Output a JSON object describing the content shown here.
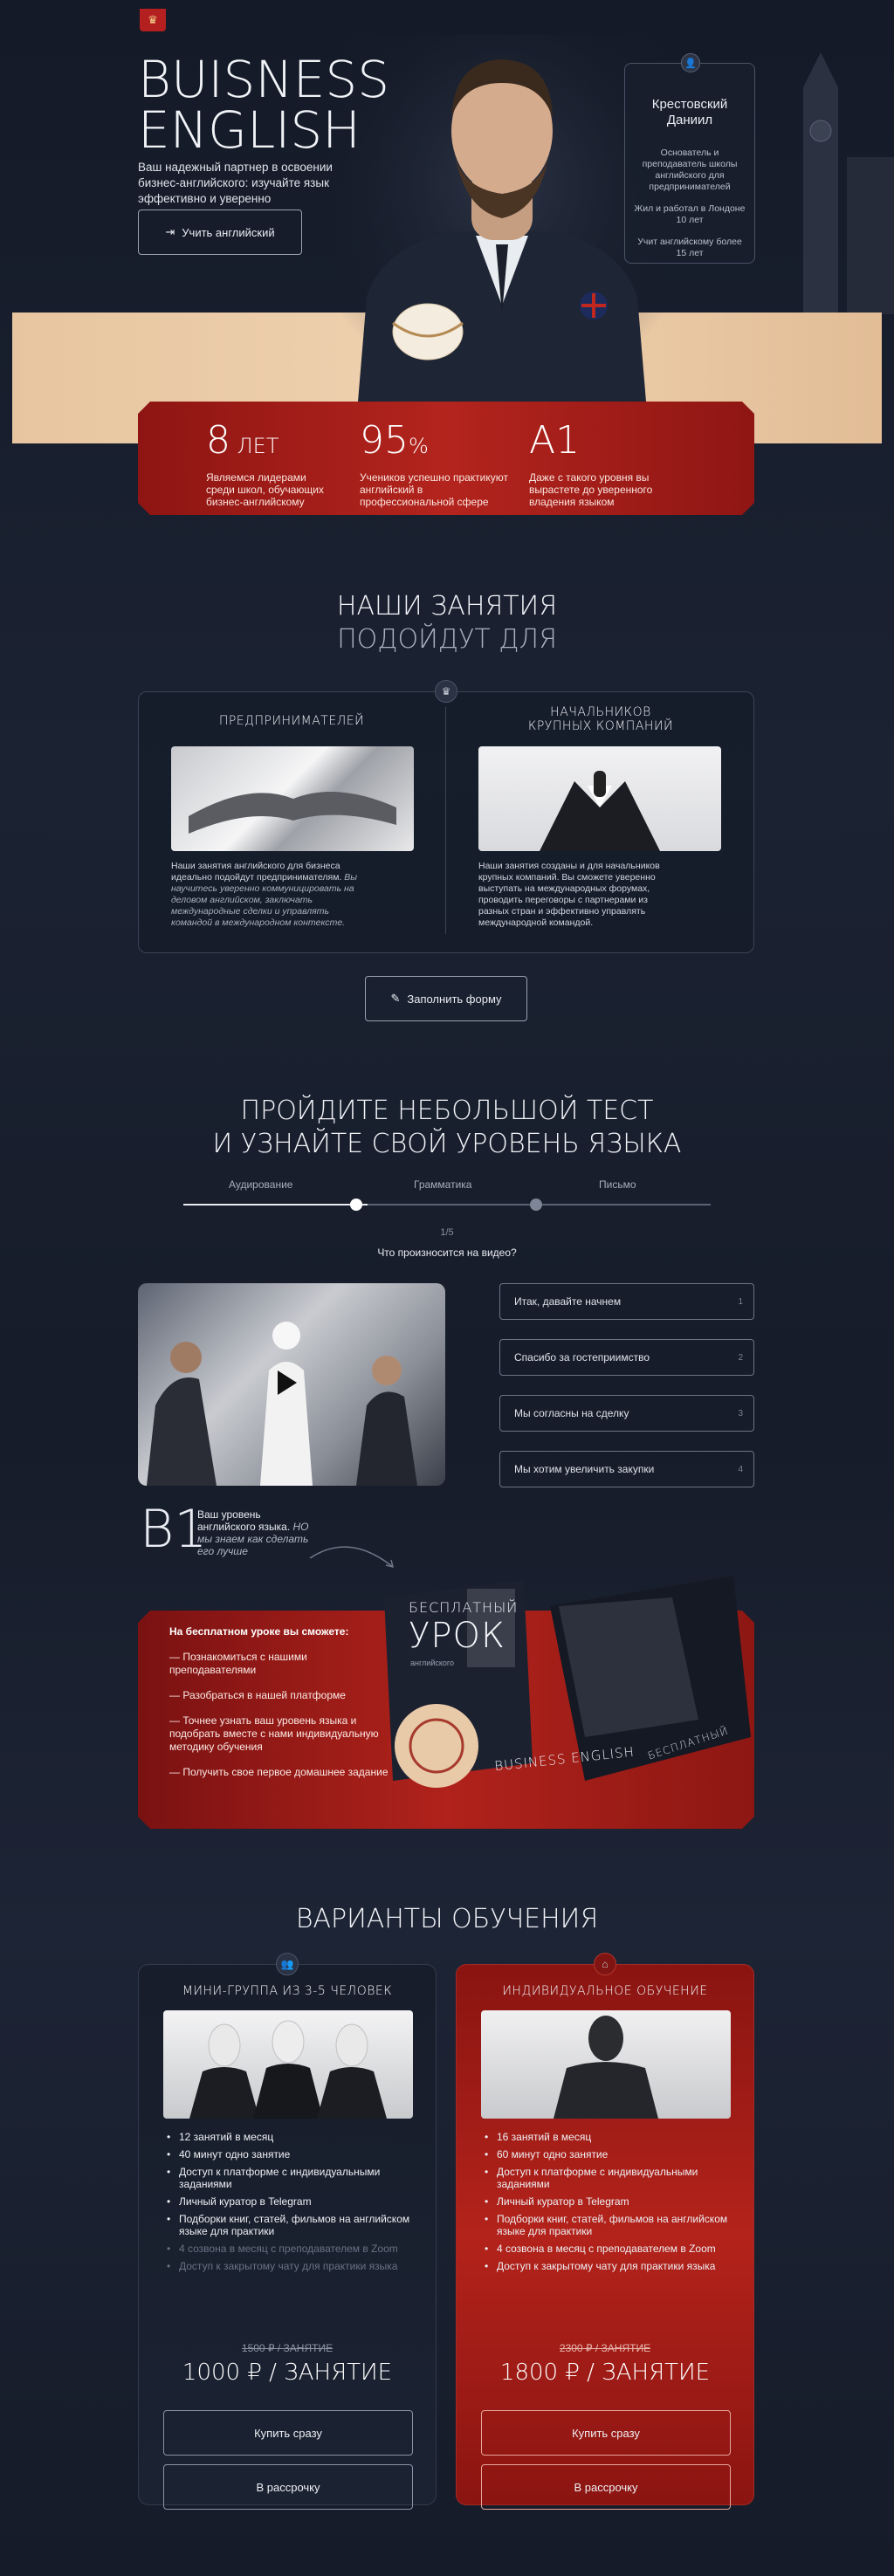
{
  "header": {
    "logo_glyph": "♛"
  },
  "hero": {
    "title_line1": "BUISNESS",
    "title_line2": "ENGLISH",
    "subtitle": "Ваш надежный партнер в освоении бизнес-английского: изучайте язык эффективно и уверенно",
    "cta_label": "Учить английский",
    "cta_icon": "login-icon"
  },
  "teacher": {
    "name": "Крестовский Даниил",
    "desc1": "Основатель и преподаватель школы английского для предпринимателей",
    "desc2": "Жил и работал в Лондоне 10 лет",
    "desc3": "Учит английскому более 15 лет"
  },
  "stats": [
    {
      "value": "8",
      "suffix": " ЛЕТ",
      "text": "Являемся лидерами среди школ, обучающих бизнес-английскому"
    },
    {
      "value": "95",
      "suffix": "%",
      "text": "Учеников успешно практикуют английский в профессиональной сфере"
    },
    {
      "value": "A1",
      "suffix": "",
      "text": "Даже с такого уровня вы вырастете до уверенного владения языком"
    }
  ],
  "audience": {
    "heading_l1": "НАШИ ЗАНЯТИЯ",
    "heading_l2": "ПОДОЙДУТ ДЛЯ",
    "col1_title": "ПРЕДПРИНИМАТЕЛЕЙ",
    "col1_text": "Наши занятия английского для бизнеса идеально подойдут предпринимателям.",
    "col1_text_italic": "Вы научитесь уверенно коммуницировать на деловом английском, заключать международные сделки и управлять командой в международном контексте.",
    "col2_title_l1": "НАЧАЛЬНИКОВ",
    "col2_title_l2": "КРУПНЫХ КОМПАНИЙ",
    "col2_text": "Наши занятия созданы и для начальников крупных компаний. Вы сможете уверенно выступать на международных форумах, проводить переговоры с партнерами из разных стран и эффективно управлять международной командой.",
    "form_button": "Заполнить форму"
  },
  "test": {
    "heading_l1": "ПРОЙДИТЕ НЕБОЛЬШОЙ ТЕСТ",
    "heading_l2": "И УЗНАЙТЕ СВОЙ УРОВЕНЬ ЯЗЫКА",
    "steps": [
      "Аудирование",
      "Грамматика",
      "Письмо"
    ],
    "progress": 0.35,
    "counter": "1/5",
    "question": "Что произносится на видео?",
    "answers": [
      {
        "text": "Итак, давайте начнем",
        "key": "1"
      },
      {
        "text": "Спасибо за гостеприимство",
        "key": "2"
      },
      {
        "text": "Мы согласны на сделку",
        "key": "3"
      },
      {
        "text": "Мы хотим увеличить закупки",
        "key": "4"
      }
    ],
    "level": "B1",
    "level_text": "Ваш уровень английского языка.",
    "level_text_italic": "НО мы знаем как сделать его лучше"
  },
  "free_lesson": {
    "heading": "На бесплатном уроке вы сможете:",
    "items": [
      "— Познакомиться с нашими преподавателями",
      "— Разобраться в нашей платформе",
      "— Точнее узнать ваш уровень языка и подобрать вместе с нами индивидуальную методику обучения",
      "— Получить свое первое домашнее задание"
    ],
    "box_title_l1": "БЕСПЛАТНЫЙ",
    "box_title_l2": "УРОК",
    "box_sub": "английского",
    "box_brand": "BUSINESS ENGLISH",
    "box_side": "БЕСПЛАТНЫЙ"
  },
  "plans": {
    "heading": "ВАРИАНТЫ ОБУЧЕНИЯ",
    "group": {
      "title": "МИНИ-ГРУППА ИЗ 3-5 ЧЕЛОВЕК",
      "features": [
        "12 занятий в месяц",
        "40 минут одно занятие",
        "Доступ к платформе с индивидуальными заданиями",
        "Личный куратор в Telegram",
        "Подборки книг, статей, фильмов на английском языке для практики"
      ],
      "features_off": [
        "4 созвона в месяц с преподавателем в Zoom",
        "Доступ к закрытому чату для практики языка"
      ],
      "old_price": "1500 ₽ / ЗАНЯТИЕ",
      "price": "1000 ₽ / ЗАНЯТИЕ",
      "buy": "Купить сразу",
      "installment": "В рассрочку"
    },
    "individual": {
      "title": "ИНДИВИДУАЛЬНОЕ ОБУЧЕНИЕ",
      "features": [
        "16 занятий в месяц",
        "60 минут одно занятие",
        "Доступ к платформе с индивидуальными заданиями",
        "Личный куратор в Telegram",
        "Подборки книг, статей, фильмов на английском языке для практики",
        "4 созвона в месяц с преподавателем в Zoom",
        "Доступ к закрытому чату для практики языка"
      ],
      "old_price": "2300 ₽ / ЗАНЯТИЕ",
      "price": "1800 ₽ / ЗАНЯТИЕ",
      "buy": "Купить сразу",
      "installment": "В рассрочку"
    }
  }
}
